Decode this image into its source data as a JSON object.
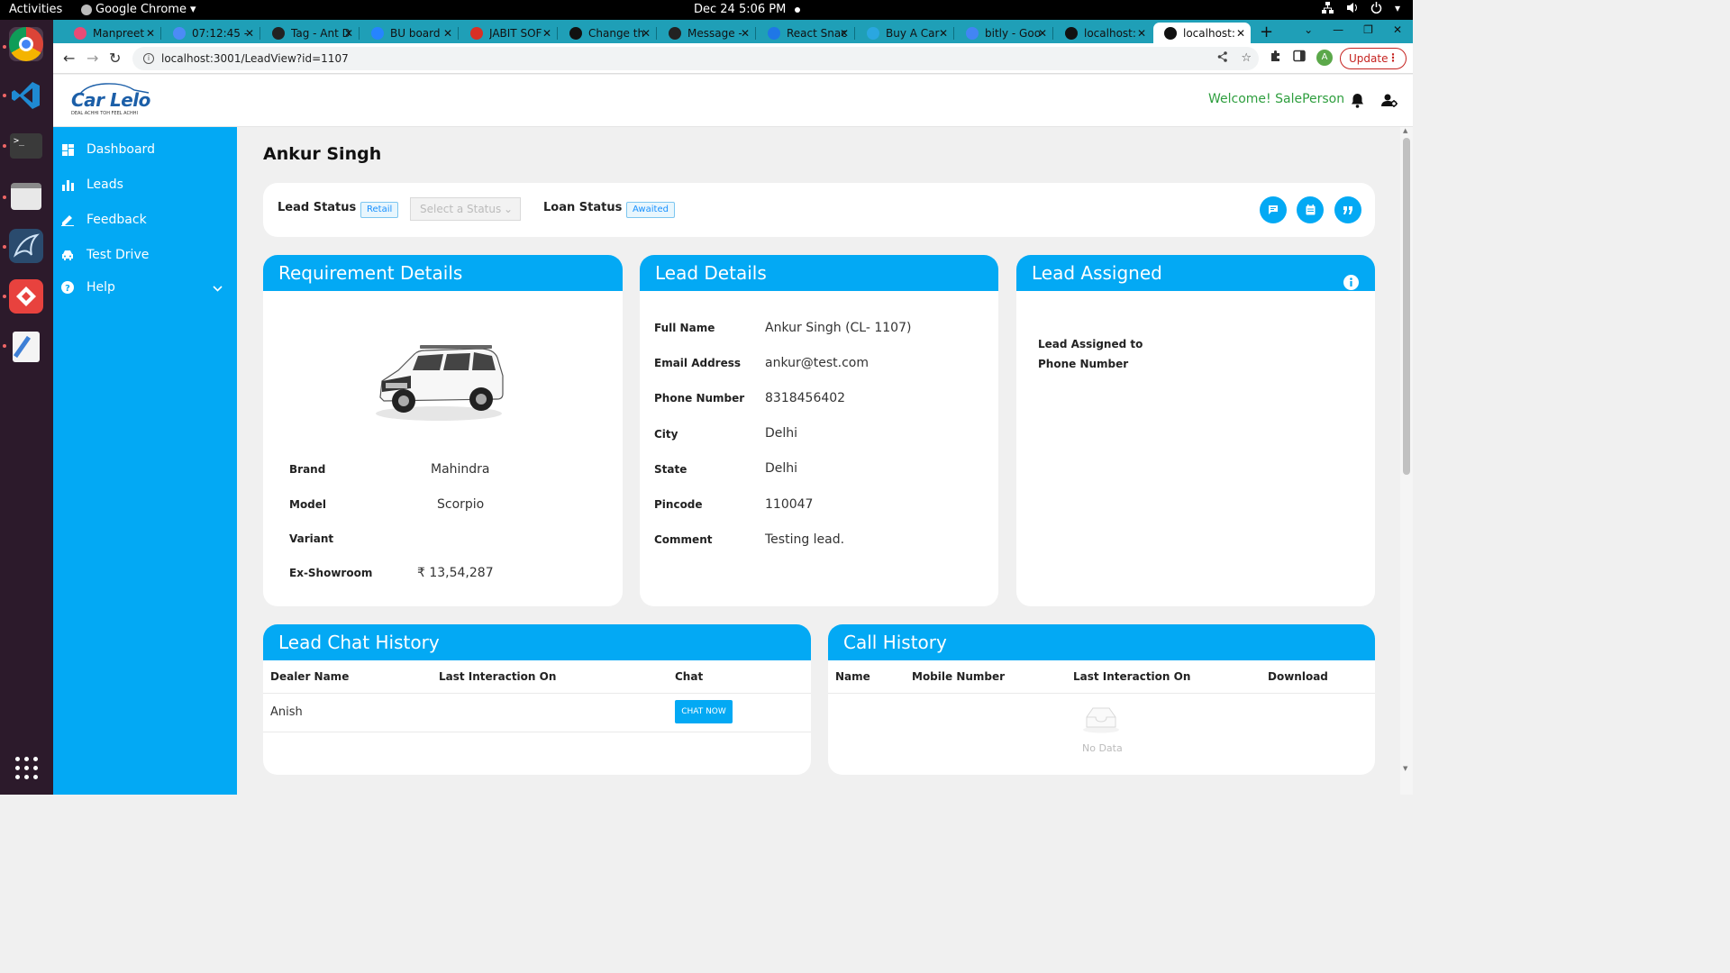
{
  "os": {
    "activities": "Activities",
    "app_name": "Google Chrome",
    "clock": "Dec 24  5:06 PM"
  },
  "tabs": [
    {
      "label": "Manpreet",
      "favicon_color": "#e94b76"
    },
    {
      "label": "07:12:45 -",
      "favicon_color": "#4c8bf5"
    },
    {
      "label": "Tag - Ant D",
      "favicon_color": "#222222"
    },
    {
      "label": "BU board",
      "favicon_color": "#2684ff"
    },
    {
      "label": "JABIT SOF",
      "favicon_color": "#d93025"
    },
    {
      "label": "Change th",
      "favicon_color": "#111111"
    },
    {
      "label": "Message -",
      "favicon_color": "#222222"
    },
    {
      "label": "React Snac",
      "favicon_color": "#1f77e6"
    },
    {
      "label": "Buy A Car",
      "favicon_color": "#2aa7e0"
    },
    {
      "label": "bitly - Goo",
      "favicon_color": "#4285f4"
    },
    {
      "label": "localhost:",
      "favicon_color": "#111111"
    },
    {
      "label": "localhost:",
      "favicon_color": "#111111",
      "active": true
    }
  ],
  "browser": {
    "url": "localhost:3001/LeadView?id=1107",
    "update_label": "Update",
    "avatar_letter": "A"
  },
  "header": {
    "logo_text": "Car Lelo",
    "logo_tagline": "DEAL ACHHI TOH FEEL ACHHI",
    "welcome": "Welcome! SalePerson"
  },
  "sidebar": {
    "items": [
      {
        "label": "Dashboard",
        "icon": "dashboard-icon"
      },
      {
        "label": "Leads",
        "icon": "bar-chart-icon"
      },
      {
        "label": "Feedback",
        "icon": "edit-icon"
      },
      {
        "label": "Test Drive",
        "icon": "car-icon"
      },
      {
        "label": "Help",
        "icon": "question-icon"
      }
    ]
  },
  "page": {
    "title": "Ankur Singh",
    "lead_status_label": "Lead Status",
    "lead_status_tag": "Retail",
    "status_placeholder": "Select a Status",
    "loan_status_label": "Loan Status",
    "loan_status_tag": "Awaited"
  },
  "requirement": {
    "title": "Requirement Details",
    "fields": [
      {
        "label": "Brand",
        "value": "Mahindra"
      },
      {
        "label": "Model",
        "value": "Scorpio"
      },
      {
        "label": "Variant",
        "value": ""
      },
      {
        "label": "Ex-Showroom",
        "value": "₹ 13,54,287"
      }
    ]
  },
  "lead_details": {
    "title": "Lead Details",
    "fields": [
      {
        "label": "Full Name",
        "value": "Ankur Singh (CL- 1107)"
      },
      {
        "label": "Email Address",
        "value": "ankur@test.com"
      },
      {
        "label": "Phone Number",
        "value": "8318456402"
      },
      {
        "label": "City",
        "value": "Delhi"
      },
      {
        "label": "State",
        "value": "Delhi"
      },
      {
        "label": "Pincode",
        "value": "110047"
      },
      {
        "label": "Comment",
        "value": "Testing lead."
      }
    ]
  },
  "lead_assigned": {
    "title": "Lead Assigned",
    "fields": [
      {
        "label": "Lead Assigned to"
      },
      {
        "label": "Phone Number"
      }
    ]
  },
  "chat_history": {
    "title": "Lead Chat History",
    "columns": [
      "Dealer Name",
      "Last Interaction On",
      "Chat"
    ],
    "rows": [
      {
        "dealer": "Anish",
        "last": "",
        "action": "CHAT NOW"
      }
    ]
  },
  "call_history": {
    "title": "Call History",
    "columns": [
      "Name",
      "Mobile Number",
      "Last Interaction On",
      "Download"
    ],
    "empty_text": "No Data"
  },
  "colors": {
    "primary": "#03a9f4",
    "welcome_green": "#2e9e3e",
    "tab_strip": "#1f9fb7"
  }
}
